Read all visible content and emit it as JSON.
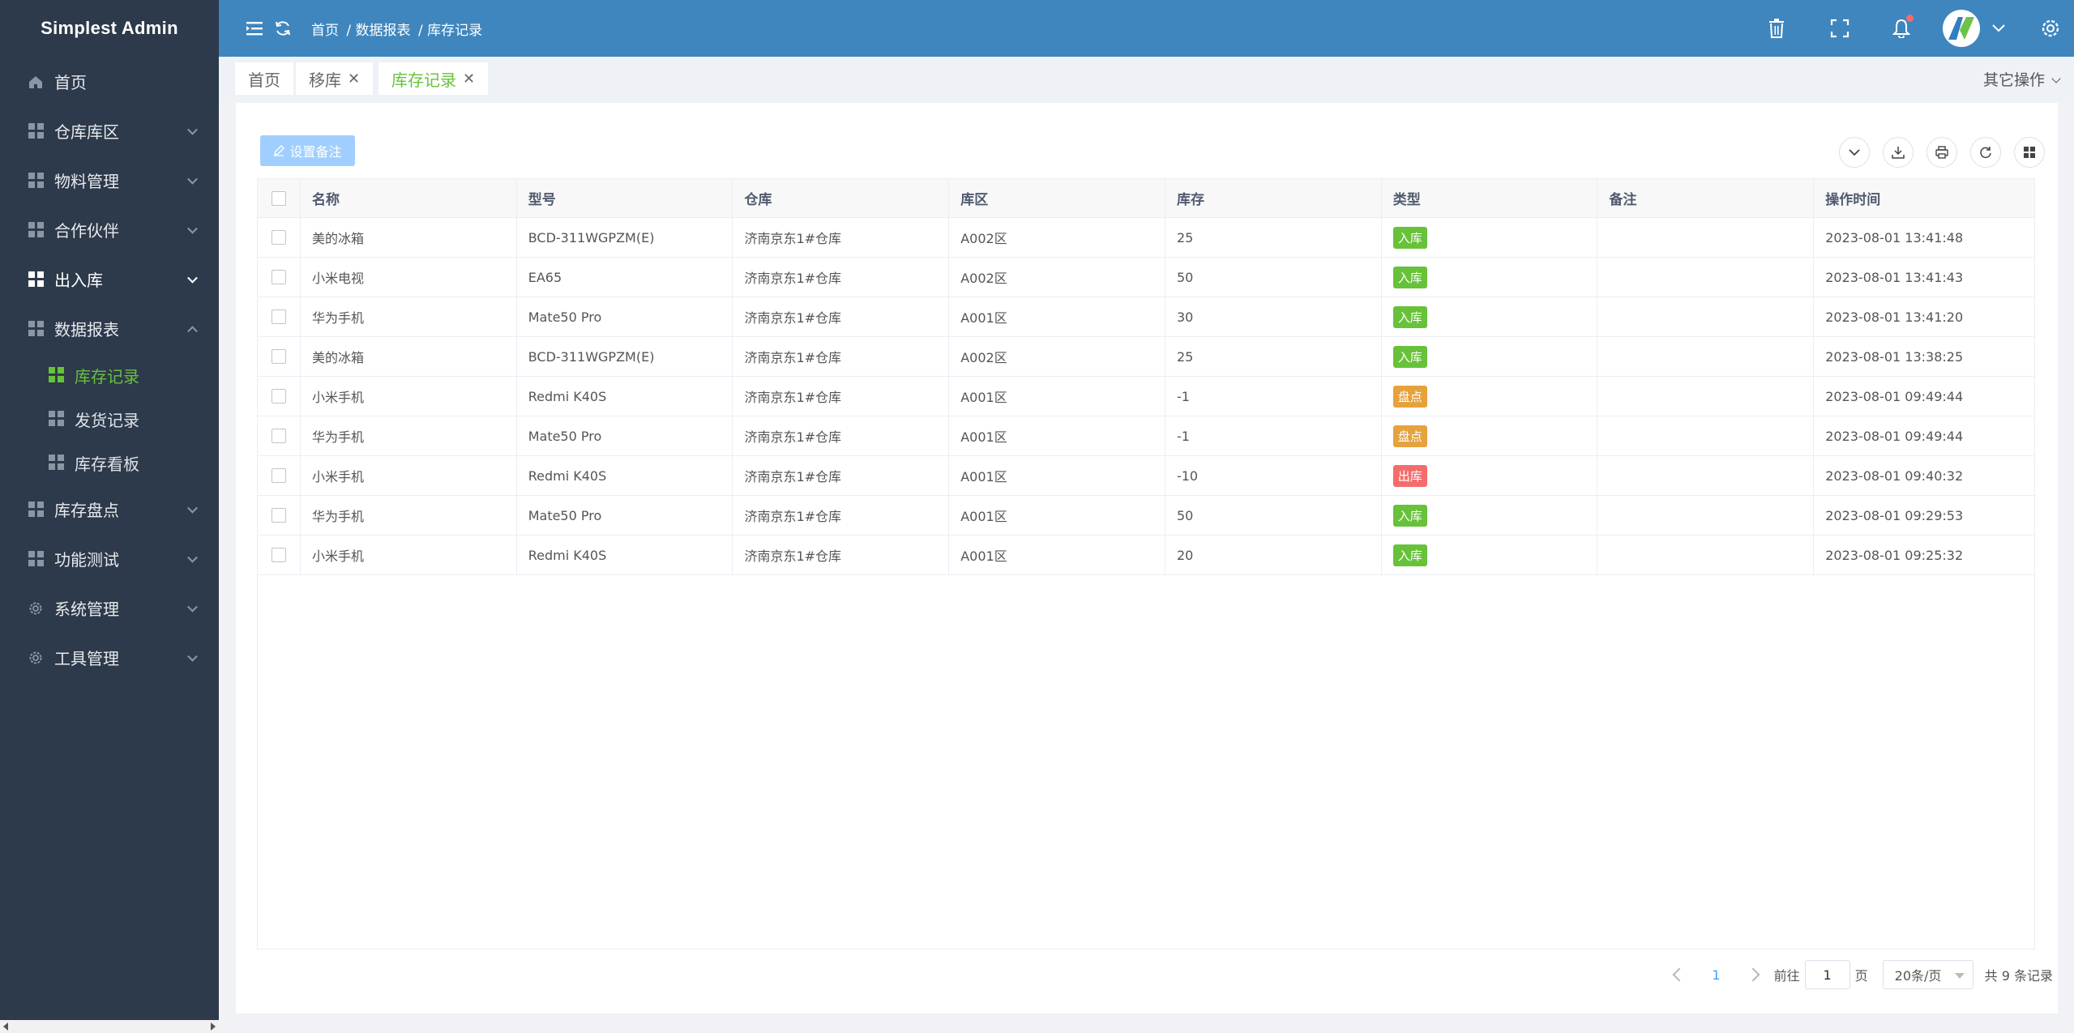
{
  "brand": "Simplest Admin",
  "sidebar": {
    "items": [
      {
        "label": "首页"
      },
      {
        "label": "仓库库区"
      },
      {
        "label": "物料管理"
      },
      {
        "label": "合作伙伴"
      },
      {
        "label": "出入库"
      },
      {
        "label": "数据报表"
      },
      {
        "label": "库存盘点"
      },
      {
        "label": "功能测试"
      },
      {
        "label": "系统管理"
      },
      {
        "label": "工具管理"
      }
    ],
    "subitems": [
      {
        "label": "库存记录"
      },
      {
        "label": "发货记录"
      },
      {
        "label": "库存看板"
      }
    ]
  },
  "breadcrumb": [
    "首页",
    "/ 数据报表",
    "/ 库存记录"
  ],
  "tabs": [
    {
      "label": "首页"
    },
    {
      "label": "移库"
    },
    {
      "label": "库存记录"
    }
  ],
  "other_ops": "其它操作",
  "toolbar": {
    "set_note": "设置备注"
  },
  "table": {
    "headers": [
      "名称",
      "型号",
      "仓库",
      "库区",
      "库存",
      "类型",
      "备注",
      "操作时间"
    ],
    "rows": [
      {
        "name": "美的冰箱",
        "model": "BCD-311WGPZM(E)",
        "warehouse": "济南京东1#仓库",
        "area": "A002区",
        "stock": "25",
        "type": "入库",
        "note": "",
        "time": "2023-08-01 13:41:48"
      },
      {
        "name": "小米电视",
        "model": "EA65",
        "warehouse": "济南京东1#仓库",
        "area": "A002区",
        "stock": "50",
        "type": "入库",
        "note": "",
        "time": "2023-08-01 13:41:43"
      },
      {
        "name": "华为手机",
        "model": "Mate50 Pro",
        "warehouse": "济南京东1#仓库",
        "area": "A001区",
        "stock": "30",
        "type": "入库",
        "note": "",
        "time": "2023-08-01 13:41:20"
      },
      {
        "name": "美的冰箱",
        "model": "BCD-311WGPZM(E)",
        "warehouse": "济南京东1#仓库",
        "area": "A002区",
        "stock": "25",
        "type": "入库",
        "note": "",
        "time": "2023-08-01 13:38:25"
      },
      {
        "name": "小米手机",
        "model": "Redmi K40S",
        "warehouse": "济南京东1#仓库",
        "area": "A001区",
        "stock": "-1",
        "type": "盘点",
        "note": "",
        "time": "2023-08-01 09:49:44"
      },
      {
        "name": "华为手机",
        "model": "Mate50 Pro",
        "warehouse": "济南京东1#仓库",
        "area": "A001区",
        "stock": "-1",
        "type": "盘点",
        "note": "",
        "time": "2023-08-01 09:49:44"
      },
      {
        "name": "小米手机",
        "model": "Redmi K40S",
        "warehouse": "济南京东1#仓库",
        "area": "A001区",
        "stock": "-10",
        "type": "出库",
        "note": "",
        "time": "2023-08-01 09:40:32"
      },
      {
        "name": "华为手机",
        "model": "Mate50 Pro",
        "warehouse": "济南京东1#仓库",
        "area": "A001区",
        "stock": "50",
        "type": "入库",
        "note": "",
        "time": "2023-08-01 09:29:53"
      },
      {
        "name": "小米手机",
        "model": "Redmi K40S",
        "warehouse": "济南京东1#仓库",
        "area": "A001区",
        "stock": "20",
        "type": "入库",
        "note": "",
        "time": "2023-08-01 09:25:32"
      }
    ]
  },
  "pager": {
    "current": "1",
    "goto_prefix": "前往",
    "goto_value": "1",
    "goto_suffix": "页",
    "page_size": "20条/页",
    "total": "共 9 条记录"
  },
  "colors": {
    "sidebar": "#2d3a4b",
    "topbar": "#3f86be",
    "accent": "#67c23a",
    "warn": "#e6a23c",
    "danger": "#f56c6c"
  }
}
